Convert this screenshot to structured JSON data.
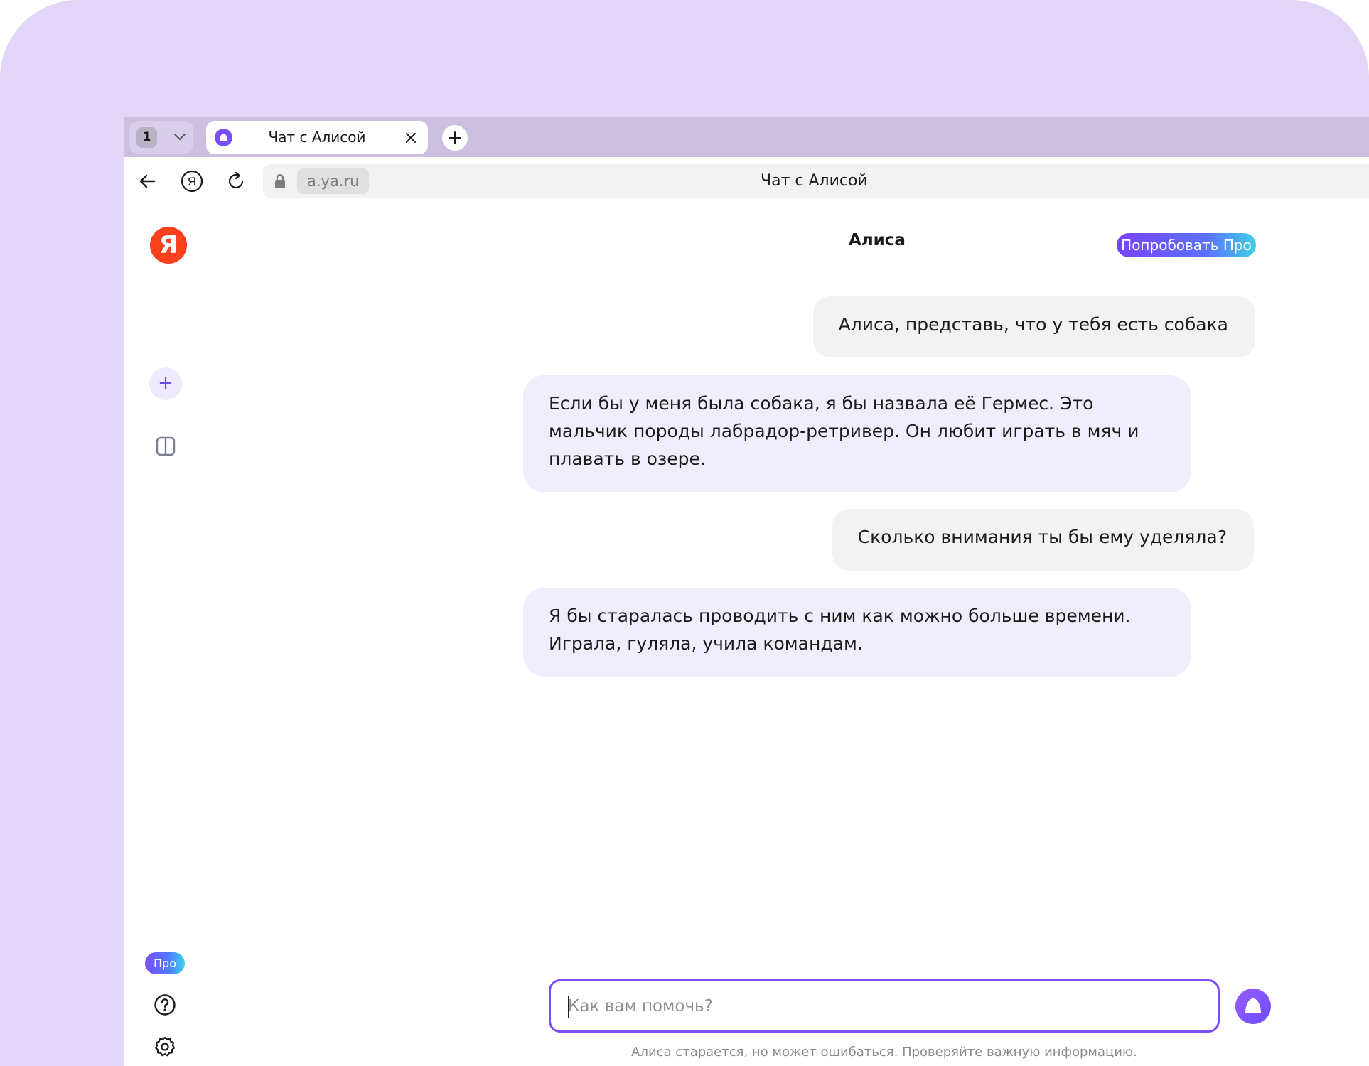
{
  "browser": {
    "tab_count": "1",
    "active_tab": {
      "title": "Чат с Алисой",
      "favicon": "alice-icon"
    },
    "address": {
      "domain": "a.ya.ru",
      "page_title": "Чат с Алисой"
    },
    "icons": {
      "back": "arrow-left-icon",
      "yandex": "yandex-circle-icon",
      "reload": "reload-icon",
      "lock": "lock-icon",
      "new_tab": "plus-icon"
    }
  },
  "sidebar": {
    "logo_letter": "Я",
    "new_chat_label": "+",
    "pro_badge": "Про"
  },
  "header": {
    "title": "Алиса",
    "try_pro_label": "Попробовать Про"
  },
  "messages": [
    {
      "role": "user",
      "text": "Алиса, представь, что у тебя есть собака"
    },
    {
      "role": "assistant",
      "text": "Если бы у меня была собака, я бы назвала её Гермес. Это мальчик породы лабрадор-ретривер. Он любит играть в мяч и плавать в озере."
    },
    {
      "role": "user",
      "text": "Сколько внимания ты бы ему уделяла?"
    },
    {
      "role": "assistant",
      "text": "Я бы старалась проводить с ним как можно больше времени. Играла, гуляла, учила командам."
    }
  ],
  "composer": {
    "placeholder": "Как вам помочь?",
    "value": ""
  },
  "disclaimer": "Алиса старается, но может ошибаться. Проверяйте важную информацию.",
  "colors": {
    "frame": "#e3d5f7",
    "accent": "#7a4dff",
    "yandex_red": "#fc3f1d",
    "bot_bubble": "#f0eefc",
    "user_bubble": "#f2f2f2"
  }
}
